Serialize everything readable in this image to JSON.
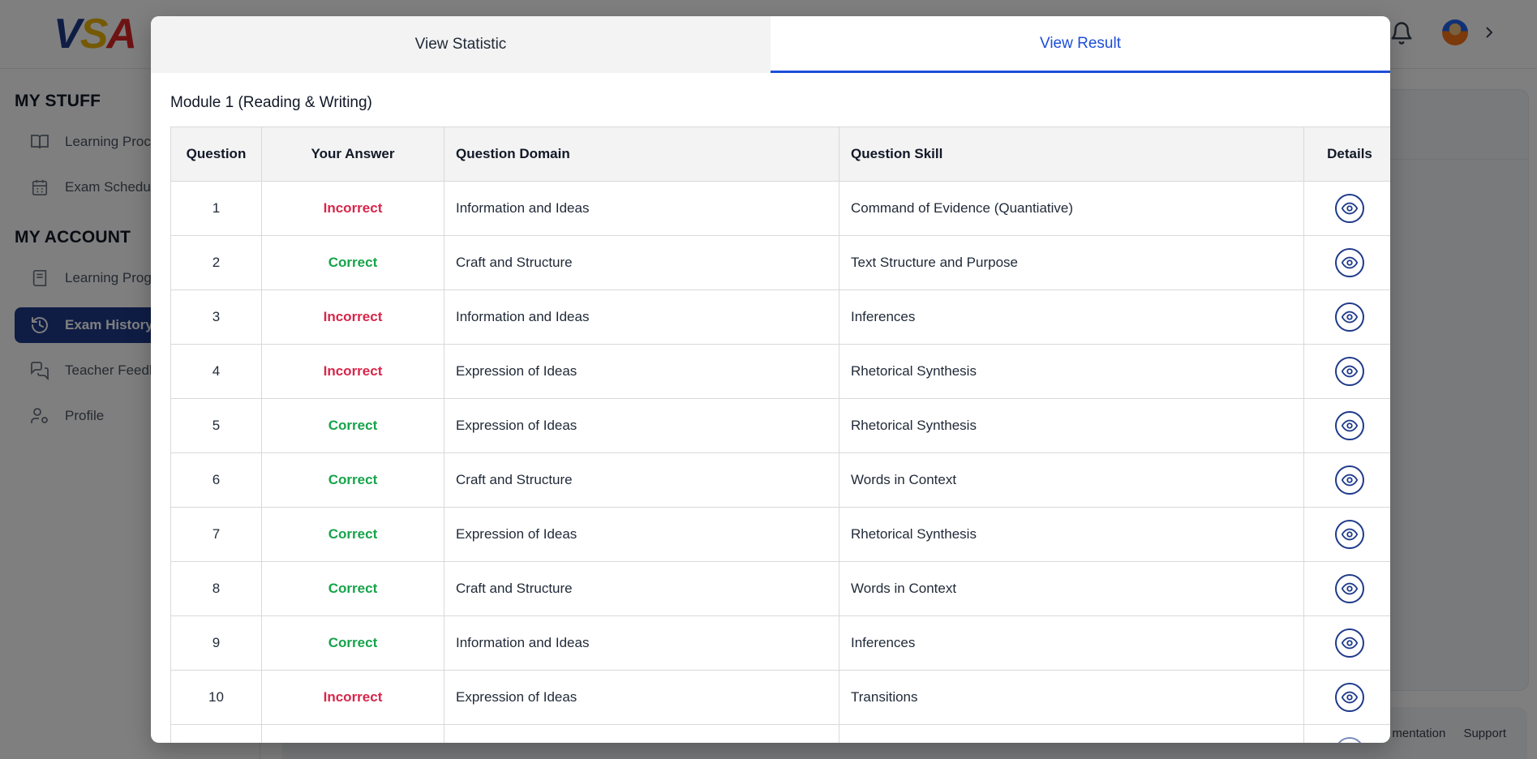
{
  "app": {
    "logo_text": [
      "V",
      "S",
      "A"
    ],
    "nav": {
      "sections": [
        {
          "title": "MY STUFF",
          "items": [
            {
              "label": "Learning Proce",
              "icon": "book-icon"
            },
            {
              "label": "Exam Schedule",
              "icon": "calendar-icon"
            }
          ]
        },
        {
          "title": "MY ACCOUNT",
          "items": [
            {
              "label": "Learning Progr",
              "icon": "notebook-icon"
            },
            {
              "label": "Exam History",
              "icon": "history-icon",
              "active": true
            },
            {
              "label": "Teacher Feedb",
              "icon": "chat-icon"
            },
            {
              "label": "Profile",
              "icon": "user-settings-icon"
            }
          ]
        }
      ]
    },
    "footer": {
      "links": [
        "mentation",
        "Support"
      ]
    },
    "colors": {
      "primary": "#1e3a8a",
      "accent": "#1d4ed8",
      "correct": "#16a34a",
      "incorrect": "#d7264a"
    }
  },
  "modal": {
    "tabs": [
      {
        "label": "View Statistic",
        "active": false
      },
      {
        "label": "View Result",
        "active": true
      }
    ],
    "section_title": "Module 1 (Reading & Writing)",
    "table": {
      "headers": [
        "Question",
        "Your Answer",
        "Question Domain",
        "Question Skill",
        "Details"
      ],
      "rows": [
        {
          "q": "1",
          "answer": "Incorrect",
          "domain": "Information and Ideas",
          "skill": "Command of Evidence (Quantiative)"
        },
        {
          "q": "2",
          "answer": "Correct",
          "domain": "Craft and Structure",
          "skill": "Text Structure and Purpose"
        },
        {
          "q": "3",
          "answer": "Incorrect",
          "domain": "Information and Ideas",
          "skill": "Inferences"
        },
        {
          "q": "4",
          "answer": "Incorrect",
          "domain": "Expression of Ideas",
          "skill": "Rhetorical Synthesis"
        },
        {
          "q": "5",
          "answer": "Correct",
          "domain": "Expression of Ideas",
          "skill": "Rhetorical Synthesis"
        },
        {
          "q": "6",
          "answer": "Correct",
          "domain": "Craft and Structure",
          "skill": "Words in Context"
        },
        {
          "q": "7",
          "answer": "Correct",
          "domain": "Expression of Ideas",
          "skill": "Rhetorical Synthesis"
        },
        {
          "q": "8",
          "answer": "Correct",
          "domain": "Craft and Structure",
          "skill": "Words in Context"
        },
        {
          "q": "9",
          "answer": "Correct",
          "domain": "Information and Ideas",
          "skill": "Inferences"
        },
        {
          "q": "10",
          "answer": "Incorrect",
          "domain": "Expression of Ideas",
          "skill": "Transitions"
        },
        {
          "q": "",
          "answer": "",
          "domain": "",
          "skill": ""
        }
      ]
    }
  }
}
